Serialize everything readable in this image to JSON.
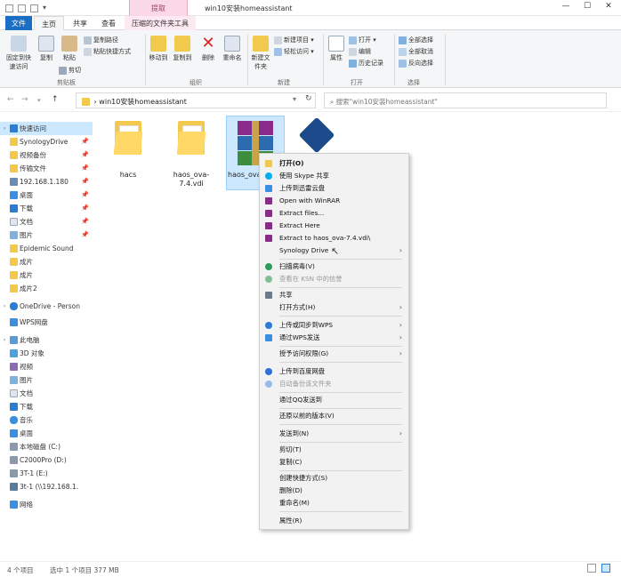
{
  "window": {
    "title": "win10安装homeassistant",
    "context_tab": "提取",
    "min": "—",
    "max": "☐",
    "close": "✕"
  },
  "tabs": [
    {
      "label": "文件"
    },
    {
      "label": "主页"
    },
    {
      "label": "共享"
    },
    {
      "label": "查看"
    },
    {
      "label": "压缩的文件夹工具"
    }
  ],
  "ribbon": {
    "pin_quick": "固定到快速访问",
    "copy": "复制",
    "paste": "粘贴",
    "copy_path": "复制路径",
    "paste_shortcut": "粘贴快捷方式",
    "cut": "剪切",
    "clipboard": "剪贴板",
    "move_to": "移动到",
    "copy_to": "复制到",
    "delete": "删除",
    "rename": "重命名",
    "organize": "组织",
    "new_folder": "新建文件夹",
    "new_item": "新建项目 ▾",
    "easy_access": "轻松访问 ▾",
    "new": "新建",
    "properties": "属性",
    "open": "打开 ▾",
    "edit": "编辑",
    "history": "历史记录",
    "open_group": "打开",
    "select_all": "全部选择",
    "select_none": "全部取消",
    "invert": "反向选择",
    "select": "选择"
  },
  "address": {
    "back": "←",
    "forward": "→",
    "up": "↑",
    "path_sep": "›",
    "path": "win10安装homeassistant",
    "refresh": "↻",
    "search_placeholder": "搜索\"win10安装homeassistant\""
  },
  "sidebar": {
    "items": [
      {
        "label": "快速访问",
        "pin": ""
      },
      {
        "label": "SynologyDrive",
        "pin": "📌"
      },
      {
        "label": "视频备份",
        "pin": "📌"
      },
      {
        "label": "传输文件",
        "pin": "📌"
      },
      {
        "label": "192.168.1.180",
        "pin": "📌"
      },
      {
        "label": "桌面",
        "pin": "📌"
      },
      {
        "label": "下载",
        "pin": "📌"
      },
      {
        "label": "文档",
        "pin": "📌"
      },
      {
        "label": "图片",
        "pin": "📌"
      },
      {
        "label": "Epidemic Sound",
        "pin": ""
      },
      {
        "label": "成片",
        "pin": ""
      },
      {
        "label": "成片",
        "pin": ""
      },
      {
        "label": "成片2",
        "pin": ""
      },
      {
        "label": "OneDrive - Person",
        "pin": ""
      },
      {
        "label": "WPS网盘",
        "pin": ""
      },
      {
        "label": "此电脑",
        "pin": ""
      },
      {
        "label": "3D 对象",
        "pin": ""
      },
      {
        "label": "视频",
        "pin": ""
      },
      {
        "label": "图片",
        "pin": ""
      },
      {
        "label": "文档",
        "pin": ""
      },
      {
        "label": "下载",
        "pin": ""
      },
      {
        "label": "音乐",
        "pin": ""
      },
      {
        "label": "桌面",
        "pin": ""
      },
      {
        "label": "本地磁盘 (C:)",
        "pin": ""
      },
      {
        "label": "C2000Pro (D:)",
        "pin": ""
      },
      {
        "label": "3T-1 (E:)",
        "pin": ""
      },
      {
        "label": "3t-1 (\\\\192.168.1.",
        "pin": ""
      },
      {
        "label": "网络",
        "pin": ""
      }
    ]
  },
  "files": [
    {
      "name": "hacs"
    },
    {
      "name": "haos_ova-7.4.vdi"
    },
    {
      "name": "haos_ova-7.4.vdi.zip"
    },
    {
      "name": ""
    }
  ],
  "status": {
    "count": "4 个项目",
    "selected": "选中 1 个项目  377 MB"
  },
  "context_menu": {
    "items": [
      {
        "label": "打开(O)"
      },
      {
        "label": "使用 Skype 共享"
      },
      {
        "label": "上传到迅雷云盘"
      },
      {
        "label": "Open with WinRAR"
      },
      {
        "label": "Extract files..."
      },
      {
        "label": "Extract Here"
      },
      {
        "label": "Extract to haos_ova-7.4.vdi\\"
      },
      {
        "label": "Synology Drive"
      },
      {
        "label": "扫描病毒(V)"
      },
      {
        "label": "查看在 KSN 中的信誉"
      },
      {
        "label": "共享"
      },
      {
        "label": "打开方式(H)"
      },
      {
        "label": "上传或同步到WPS"
      },
      {
        "label": "通过WPS发送"
      },
      {
        "label": "授予访问权限(G)"
      },
      {
        "label": "上传到百度网盘"
      },
      {
        "label": "自动备份该文件夹"
      },
      {
        "label": "通过QQ发送到"
      },
      {
        "label": "还原以前的版本(V)"
      },
      {
        "label": "发送到(N)"
      },
      {
        "label": "剪切(T)"
      },
      {
        "label": "复制(C)"
      },
      {
        "label": "创建快捷方式(S)"
      },
      {
        "label": "删除(D)"
      },
      {
        "label": "重命名(M)"
      },
      {
        "label": "属性(R)"
      }
    ],
    "submenu_arrow": "›"
  },
  "colors": {
    "accent": "#1a6fc4",
    "folder": "#ffd867",
    "selection": "#cce8ff",
    "context_tab": "#fbd8e6"
  }
}
